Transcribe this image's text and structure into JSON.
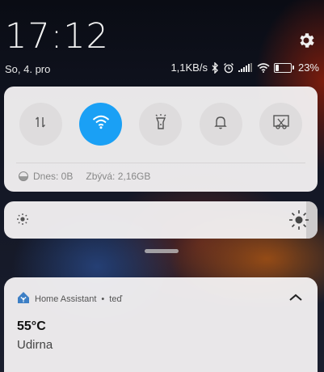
{
  "status_bar": {
    "time": "17:12",
    "date": "So, 4. pro",
    "net_speed": "1,1KB/s",
    "battery_percent": "23%",
    "battery_level": 0.23
  },
  "quick_settings": {
    "toggles": [
      {
        "icon": "data-arrows-icon",
        "active": false
      },
      {
        "icon": "wifi-icon",
        "active": true
      },
      {
        "icon": "flashlight-icon",
        "active": false
      },
      {
        "icon": "bell-icon",
        "active": false
      },
      {
        "icon": "screenshot-icon",
        "active": false
      }
    ],
    "data_today": "Dnes: 0B",
    "data_remaining": "Zbývá: 2,16GB",
    "accent_color": "#1aa0f5"
  },
  "brightness": {
    "level": 0.97
  },
  "notification": {
    "app": "Home Assistant",
    "separator": "•",
    "when": "teď",
    "title": "55°C",
    "body": "Udirna"
  }
}
